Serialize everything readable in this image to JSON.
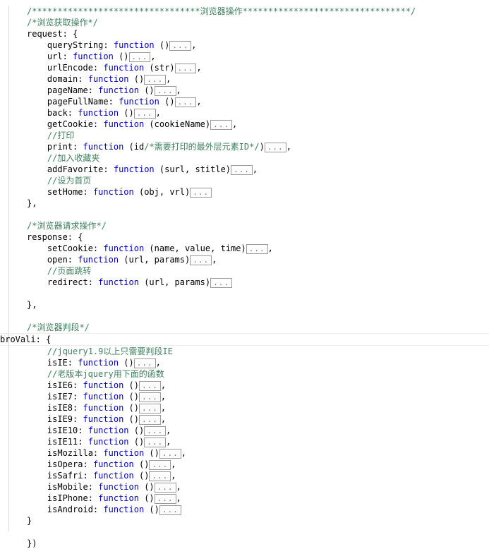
{
  "editor": {
    "language": "javascript",
    "colors": {
      "background": "#ffffff",
      "text": "#000000",
      "comment": "#3f7f5f",
      "keyword": "#0000c0",
      "fold_border": "#9a9a9a",
      "fold_text": "#707070",
      "current_line_rule": "#ececec",
      "indent_guide": "#d8d8d8"
    },
    "fold_placeholder": "...",
    "keyword": "function",
    "current_line_index": 30
  },
  "lines": [
    {
      "indent": 0,
      "type": "comment",
      "text": "/*********************************浏览器操作*********************************/"
    },
    {
      "indent": 0,
      "type": "comment",
      "text": "/*浏览获取操作*/"
    },
    {
      "indent": 0,
      "type": "code",
      "prefix": "request: {",
      "fold": false
    },
    {
      "indent": 1,
      "type": "member",
      "name": "queryString:",
      "params": "()",
      "fold": true,
      "tail": ","
    },
    {
      "indent": 1,
      "type": "member",
      "name": "url:",
      "params": "()",
      "fold": true,
      "tail": ","
    },
    {
      "indent": 1,
      "type": "member",
      "name": "urlEncode:",
      "params": "(str)",
      "fold": true,
      "tail": ","
    },
    {
      "indent": 1,
      "type": "member",
      "name": "domain:",
      "params": "()",
      "fold": true,
      "tail": ","
    },
    {
      "indent": 1,
      "type": "member",
      "name": "pageName:",
      "params": "()",
      "fold": true,
      "tail": ","
    },
    {
      "indent": 1,
      "type": "member",
      "name": "pageFullName:",
      "params": "()",
      "fold": true,
      "tail": ","
    },
    {
      "indent": 1,
      "type": "member",
      "name": "back:",
      "params": "()",
      "fold": true,
      "tail": ","
    },
    {
      "indent": 1,
      "type": "member",
      "name": "getCookie:",
      "params": "(cookieName)",
      "fold": true,
      "tail": ","
    },
    {
      "indent": 1,
      "type": "comment",
      "text": "//打印"
    },
    {
      "indent": 1,
      "type": "member",
      "name": "print:",
      "params": "(id/*需要打印的最外层元素ID*/)",
      "params_comment": "/*需要打印的最外层元素ID*/",
      "fold": true,
      "tail": ","
    },
    {
      "indent": 1,
      "type": "comment",
      "text": "//加入收藏夹"
    },
    {
      "indent": 1,
      "type": "member",
      "name": "addFavorite:",
      "params": "(surl, stitle)",
      "fold": true,
      "tail": ","
    },
    {
      "indent": 1,
      "type": "comment",
      "text": "//设为首页"
    },
    {
      "indent": 1,
      "type": "member",
      "name": "setHome:",
      "params": "(obj, vrl)",
      "fold": true,
      "tail": ""
    },
    {
      "indent": 0,
      "type": "code",
      "prefix": "},"
    },
    {
      "indent": 0,
      "type": "blank"
    },
    {
      "indent": 0,
      "type": "comment",
      "text": "/*浏览器请求操作*/"
    },
    {
      "indent": 0,
      "type": "code",
      "prefix": "response: {"
    },
    {
      "indent": 1,
      "type": "member",
      "name": "setCookie:",
      "params": "(name, value, time)",
      "fold": true,
      "tail": ","
    },
    {
      "indent": 1,
      "type": "member",
      "name": "open:",
      "params": "(url, params)",
      "fold": true,
      "tail": ","
    },
    {
      "indent": 1,
      "type": "comment",
      "text": "//页面跳转"
    },
    {
      "indent": 1,
      "type": "member",
      "name": "redirect:",
      "params": "(url, params)",
      "fold": true,
      "tail": ""
    },
    {
      "indent": 0,
      "type": "blank"
    },
    {
      "indent": 0,
      "type": "code",
      "prefix": "},"
    },
    {
      "indent": 0,
      "type": "blank"
    },
    {
      "indent": 0,
      "type": "comment",
      "text": "/*浏览器判段*/"
    },
    {
      "indent": 0,
      "type": "code",
      "prefix": "broVali: {",
      "current": true
    },
    {
      "indent": 1,
      "type": "comment",
      "text": "//jquery1.9以上只需要判段IE"
    },
    {
      "indent": 1,
      "type": "member",
      "name": "isIE:",
      "params": "()",
      "fold": true,
      "tail": ","
    },
    {
      "indent": 1,
      "type": "comment",
      "text": "//老版本jquery用下面的函数"
    },
    {
      "indent": 1,
      "type": "member",
      "name": "isIE6:",
      "params": "()",
      "fold": true,
      "tail": ","
    },
    {
      "indent": 1,
      "type": "member",
      "name": "isIE7:",
      "params": "()",
      "fold": true,
      "tail": ","
    },
    {
      "indent": 1,
      "type": "member",
      "name": "isIE8:",
      "params": "()",
      "fold": true,
      "tail": ","
    },
    {
      "indent": 1,
      "type": "member",
      "name": "isIE9:",
      "params": "()",
      "fold": true,
      "tail": ","
    },
    {
      "indent": 1,
      "type": "member",
      "name": "isIE10:",
      "params": "()",
      "fold": true,
      "tail": ","
    },
    {
      "indent": 1,
      "type": "member",
      "name": "isIE11:",
      "params": "()",
      "fold": true,
      "tail": ","
    },
    {
      "indent": 1,
      "type": "member",
      "name": "isMozilla:",
      "params": "()",
      "fold": true,
      "tail": ","
    },
    {
      "indent": 1,
      "type": "member",
      "name": "isOpera:",
      "params": "()",
      "fold": true,
      "tail": ","
    },
    {
      "indent": 1,
      "type": "member",
      "name": "isSafri:",
      "params": "()",
      "fold": true,
      "tail": ","
    },
    {
      "indent": 1,
      "type": "member",
      "name": "isMobile:",
      "params": "()",
      "fold": true,
      "tail": ","
    },
    {
      "indent": 1,
      "type": "member",
      "name": "isIPhone:",
      "params": "()",
      "fold": true,
      "tail": ","
    },
    {
      "indent": 1,
      "type": "member",
      "name": "isAndroid:",
      "params": "()",
      "fold": true,
      "tail": ""
    },
    {
      "indent": 0,
      "type": "code",
      "prefix": "}"
    },
    {
      "indent": 0,
      "type": "blank"
    },
    {
      "indent": 0,
      "type": "code",
      "prefix": "})"
    }
  ]
}
